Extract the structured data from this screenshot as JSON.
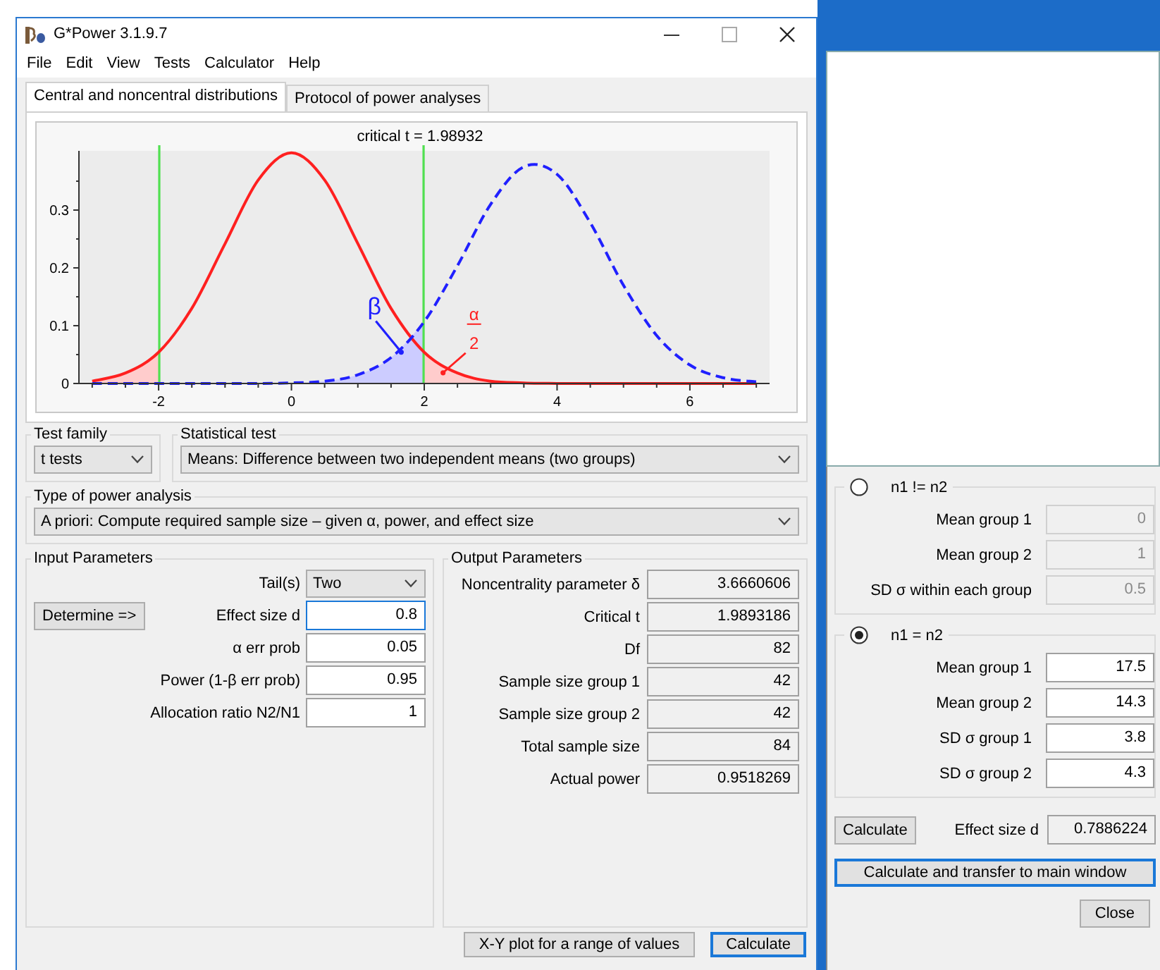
{
  "window": {
    "title": "G*Power 3.1.9.7"
  },
  "menu": [
    "File",
    "Edit",
    "View",
    "Tests",
    "Calculator",
    "Help"
  ],
  "tabs": [
    {
      "label": "Central and noncentral distributions",
      "selected": true
    },
    {
      "label": "Protocol of power analyses",
      "selected": false
    }
  ],
  "chart_data": {
    "type": "line",
    "title": "critical t = 1.98932",
    "x": [
      -3,
      -2.5,
      -2,
      -1.5,
      -1,
      -0.5,
      0,
      0.5,
      1,
      1.5,
      2,
      2.5,
      3,
      3.5,
      4,
      4.5,
      5,
      5.5,
      6,
      6.5,
      7
    ],
    "series": [
      {
        "color": "#ff2020",
        "values": [
          0.004,
          0.018,
          0.054,
          0.13,
          0.242,
          0.352,
          0.399,
          0.352,
          0.242,
          0.13,
          0.054,
          0.018,
          0.004,
          0.001,
          0,
          0,
          0,
          0,
          0,
          0,
          0
        ]
      },
      {
        "color": "#2020ff",
        "line_style": "dashed",
        "values": [
          0,
          0,
          0,
          0,
          0,
          0,
          0.001,
          0.004,
          0.015,
          0.045,
          0.107,
          0.204,
          0.31,
          0.375,
          0.362,
          0.278,
          0.17,
          0.083,
          0.032,
          0.01,
          0.003
        ]
      }
    ],
    "xlim": [
      -3.2,
      7.2
    ],
    "ylim": [
      0,
      0.4
    ],
    "xticks": [
      -2,
      0,
      2,
      4,
      6
    ],
    "yticks": [
      {
        "value": 0,
        "label": "0"
      },
      {
        "value": 0.1,
        "label": "0.1"
      },
      {
        "value": 0.2,
        "label": "0.2"
      },
      {
        "value": 0.3,
        "label": "0.3"
      }
    ],
    "ref_lines": [
      {
        "axis": "x",
        "value": -1.99
      },
      {
        "axis": "x",
        "value": 1.99
      }
    ],
    "annotations": [
      "β",
      "α",
      "2"
    ]
  },
  "test_family": {
    "label": "Test family",
    "value": "t tests"
  },
  "statistical_test": {
    "label": "Statistical test",
    "value": "Means: Difference between two independent means (two groups)"
  },
  "power_analysis_type": {
    "label": "Type of power analysis",
    "value": "A priori: Compute required sample size – given α, power, and effect size"
  },
  "input_parameters": {
    "title": "Input Parameters",
    "rows": [
      {
        "label": "Tail(s)",
        "kind": "dropdown",
        "value": "Two",
        "focused": false
      },
      {
        "label": "Effect size d",
        "kind": "field",
        "value": "0.8",
        "focused": true,
        "button": "Determine =>"
      },
      {
        "label": "α err prob",
        "kind": "field",
        "value": "0.05",
        "focused": false
      },
      {
        "label": "Power (1-β err prob)",
        "kind": "field",
        "value": "0.95",
        "focused": false
      },
      {
        "label": "Allocation ratio N2/N1",
        "kind": "field",
        "value": "1",
        "focused": false
      }
    ]
  },
  "output_parameters": {
    "title": "Output Parameters",
    "rows": [
      {
        "label": "Noncentrality parameter δ",
        "value": "3.6660606"
      },
      {
        "label": "Critical t",
        "value": "1.9893186"
      },
      {
        "label": "Df",
        "value": "82"
      },
      {
        "label": "Sample size group 1",
        "value": "42"
      },
      {
        "label": "Sample size group 2",
        "value": "42"
      },
      {
        "label": "Total sample size",
        "value": "84"
      },
      {
        "label": "Actual power",
        "value": "0.9518269"
      }
    ]
  },
  "buttons": [
    {
      "label": "X-Y plot for a range of values",
      "focused": false
    },
    {
      "label": "Calculate",
      "focused": true
    }
  ],
  "effect_size_dialog": {
    "groups": [
      {
        "label": "n1 != n2",
        "selected": false,
        "rows": [
          {
            "label": "Mean group 1",
            "value": "0"
          },
          {
            "label": "Mean group 2",
            "value": "1"
          },
          {
            "label": "SD σ within each group",
            "value": "0.5"
          }
        ]
      },
      {
        "label": "n1 = n2",
        "selected": true,
        "rows": [
          {
            "label": "Mean group 1",
            "value": "17.5"
          },
          {
            "label": "Mean group 2",
            "value": "14.3"
          },
          {
            "label": "SD σ group 1",
            "value": "3.8"
          },
          {
            "label": "SD σ group 2",
            "value": "4.3"
          }
        ]
      }
    ],
    "calculate_button": "Calculate",
    "effect_size": {
      "label": "Effect size d",
      "value": "0.7886224"
    },
    "transfer_button": {
      "label": "Calculate and transfer to main window",
      "focused": true
    },
    "close_button": "Close"
  }
}
